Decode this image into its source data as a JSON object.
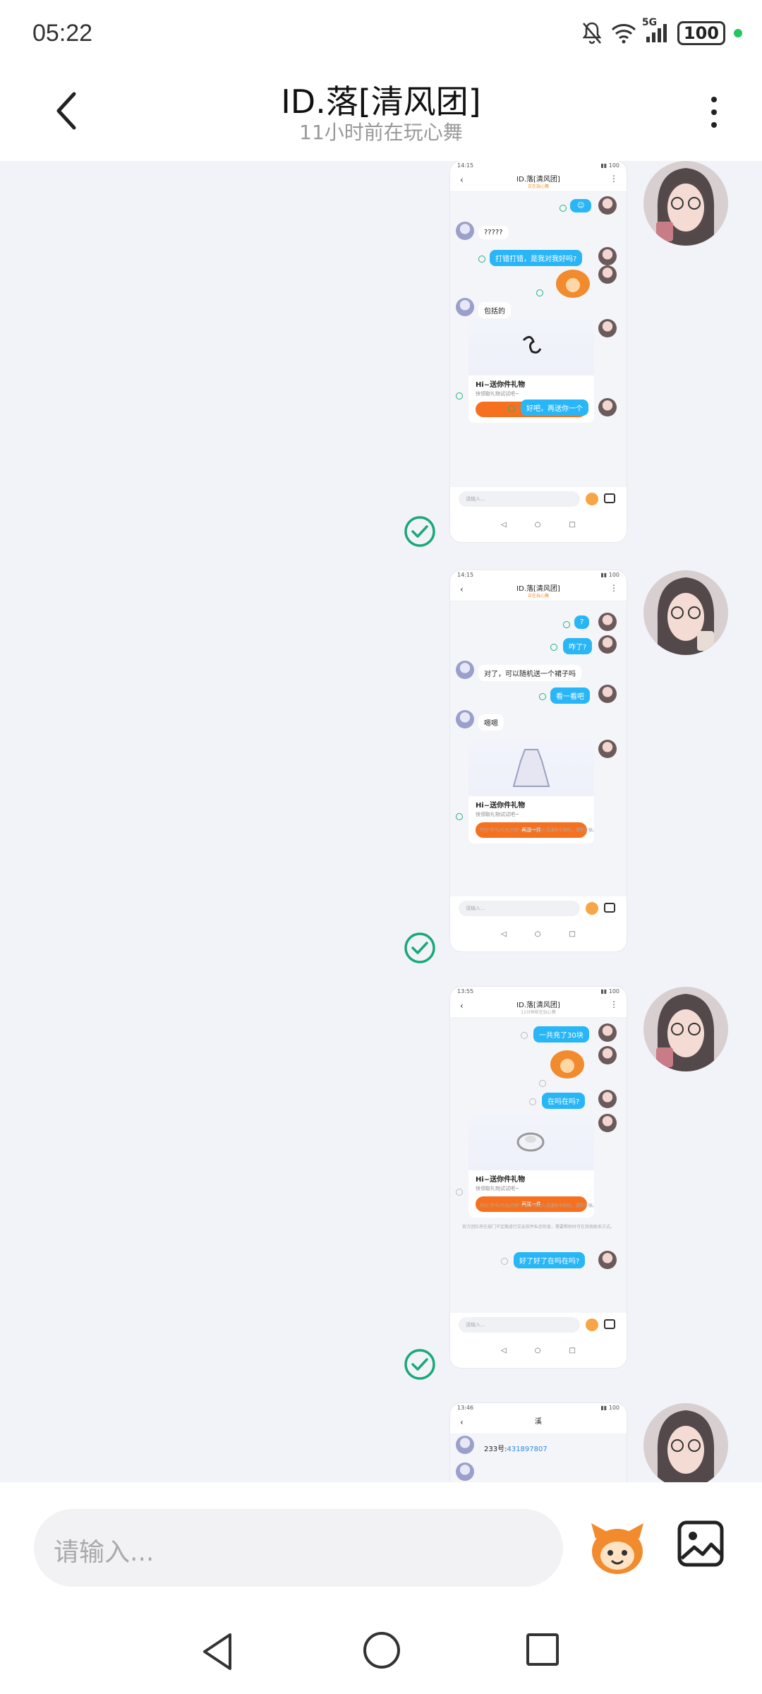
{
  "status_bar": {
    "time": "05:22",
    "network": "5G",
    "battery": "100"
  },
  "header": {
    "title": "ID.落[清风团]",
    "subtitle": "11小时前在玩心舞"
  },
  "screenshots": [
    {
      "status_time": "14:15",
      "title": "ID.落[清风团]",
      "subtitle": "正在玩心舞",
      "messages": {
        "m1": "?????",
        "m2": "打错打错，是我对我好吗?",
        "m3": "包括的",
        "m4": "好吧，再送你一个"
      },
      "gift": {
        "title": "Hi~送你件礼物",
        "desc": "快领取礼物试试吧~",
        "button": "再送一件"
      },
      "input_placeholder": "请输入..."
    },
    {
      "status_time": "14:15",
      "title": "ID.落[清风团]",
      "subtitle": "正在玩心舞",
      "messages": {
        "m1": "?",
        "m2": "咋了?",
        "m3": "对了，可以随机送一个裙子吗",
        "m4": "看一看吧",
        "m5": "嗯嗯"
      },
      "gift": {
        "title": "Hi~送你件礼物",
        "desc": "快领取礼物试试吧~",
        "button": "再送一件"
      },
      "note": "你在\"炸号/代充/代练\"，骗子和他人流通账号密码，请防诈骗。",
      "input_placeholder": "请输入..."
    },
    {
      "status_time": "13:55",
      "title": "ID.落[清风团]",
      "subtitle": "11分钟前在玩心舞",
      "messages": {
        "m1": "一共充了30块",
        "m2": "在吗在吗?",
        "m3": "好了好了在吗在吗?"
      },
      "gift": {
        "title": "Hi~送你件礼物",
        "desc": "快领取礼物试试吧~",
        "button": "再送一件"
      },
      "note": "你在\"炸号/代充/代练\"，骗子和他人流通账号密码，请防诈骗。",
      "note2": "官方团队将在部门不定期进行交友软件私信检查，需要帮助时可在其他联系方式。",
      "input_placeholder": "请输入..."
    },
    {
      "status_time": "13:46",
      "title": "溪",
      "messages": {
        "m1": "233号:",
        "m1_link": "431897807"
      }
    }
  ],
  "input": {
    "placeholder": "请输入..."
  },
  "colors": {
    "accent_blue": "#29b6f6",
    "accent_orange": "#f5711f",
    "check_green": "#20b27a"
  }
}
